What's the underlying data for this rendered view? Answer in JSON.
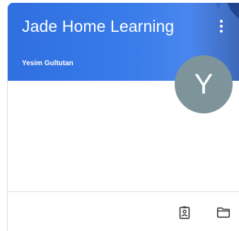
{
  "class_card": {
    "title": "Jade Home Learning",
    "teacher": "Yesim Gultutan",
    "avatar_letter": "Y",
    "header_color": "#3a7cea",
    "avatar_color": "#7d959a",
    "icons": {
      "menu": "more-vert-icon",
      "work": "assignment-ind-icon",
      "folder": "folder-icon"
    }
  }
}
